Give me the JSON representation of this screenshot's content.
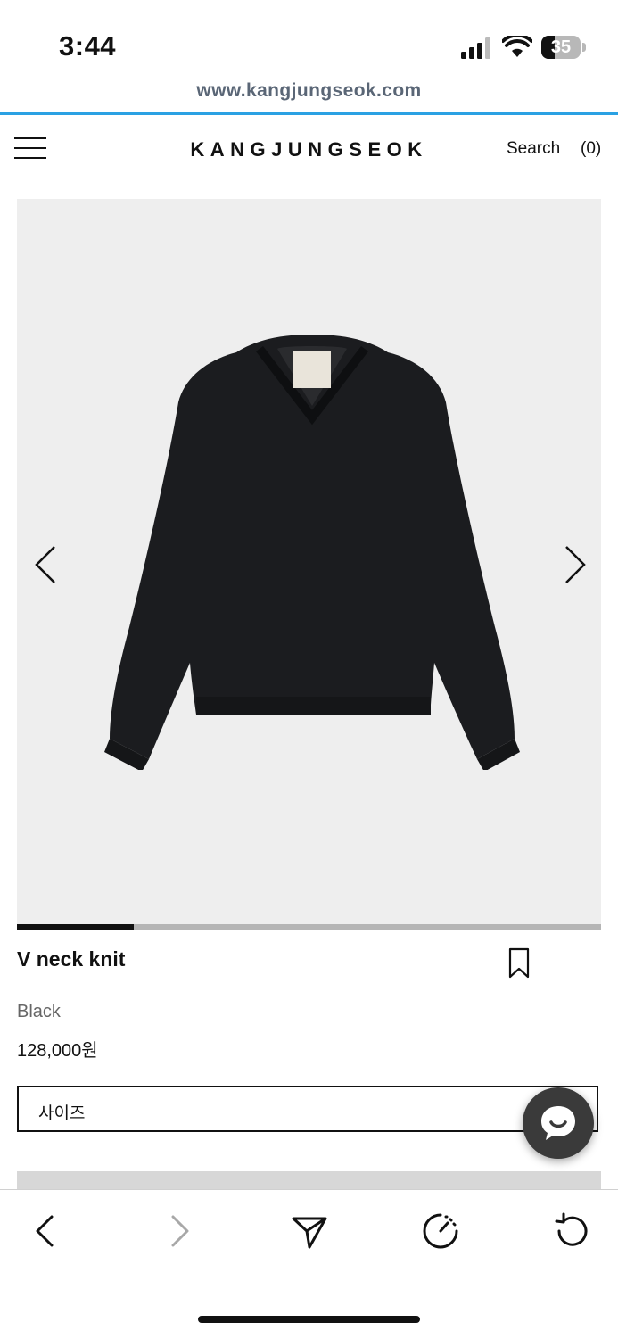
{
  "status_bar": {
    "time": "3:44",
    "battery_level": "35",
    "battery_fraction": 0.35
  },
  "browser": {
    "url": "www.kangjungseok.com",
    "accent_color": "#2aa1e3"
  },
  "header": {
    "logo": "KANGJUNGSEOK",
    "search_label": "Search",
    "cart_label": "(0)"
  },
  "gallery": {
    "progress_fraction": 0.2,
    "background_color": "#eeeeee"
  },
  "product": {
    "name": "V neck knit",
    "color": "Black",
    "price": "128,000원",
    "size_placeholder": "사이즈"
  },
  "icons": {
    "menu": "menu-icon",
    "prev": "chevron-left-icon",
    "next": "chevron-right-icon",
    "bookmark": "bookmark-icon",
    "chat": "chat-icon",
    "toolbar": [
      "back-icon",
      "forward-icon",
      "share-icon",
      "speed-icon",
      "reload-icon"
    ]
  }
}
